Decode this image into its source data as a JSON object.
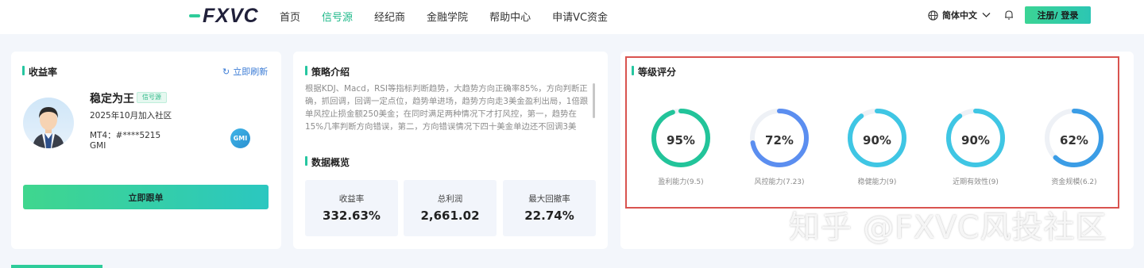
{
  "header": {
    "logo_text": "FXVC",
    "nav": [
      "首页",
      "信号源",
      "经纪商",
      "金融学院",
      "帮助中心",
      "申请VC资金"
    ],
    "active_index": 1,
    "language": "简体中文",
    "register_login": "注册/ 登录"
  },
  "profile_card": {
    "title": "收益率",
    "refresh": "立即刷新",
    "name": "稳定为王",
    "badge": "信号源",
    "joined": "2025年10月加入社区",
    "mt4": "MT4：#****5215",
    "broker": "GMI",
    "broker_logo": "GMI",
    "follow_button": "立即跟单"
  },
  "strategy_card": {
    "title": "策略介绍",
    "description": "根据KDJ、Macd，RSI等指标判断趋势，大趋势方向正确率85%，方向判断正确，抓回调，回调一定点位，趋势单进场，趋势方向走3美金盈利出局，1倍跟单风控止损金额250美金；在同时满足两种情况下才打风控，第一，趋势在15%几率判断方向错误，第二，方向错误情况下四十美金单边还不回调3美",
    "overview_title": "数据概览",
    "stats": [
      {
        "label": "收益率",
        "value": "332.63%"
      },
      {
        "label": "总利润",
        "value": "2,661.02"
      },
      {
        "label": "最大回撤率",
        "value": "22.74%"
      }
    ]
  },
  "rating_card": {
    "title": "等级评分",
    "gauges": [
      {
        "percent": 95,
        "display": "95%",
        "label": "盈利能力(9.5)",
        "color": "#22c49a"
      },
      {
        "percent": 72,
        "display": "72%",
        "label": "风控能力(7.23)",
        "color": "#5b8ef0"
      },
      {
        "percent": 90,
        "display": "90%",
        "label": "稳健能力(9)",
        "color": "#3fc6e4"
      },
      {
        "percent": 90,
        "display": "90%",
        "label": "近期有效性(9)",
        "color": "#3fc6e4"
      },
      {
        "percent": 62,
        "display": "62%",
        "label": "资金规模(6.2)",
        "color": "#3b9de6"
      }
    ]
  },
  "watermark": "知乎 @FXVC风投社区"
}
